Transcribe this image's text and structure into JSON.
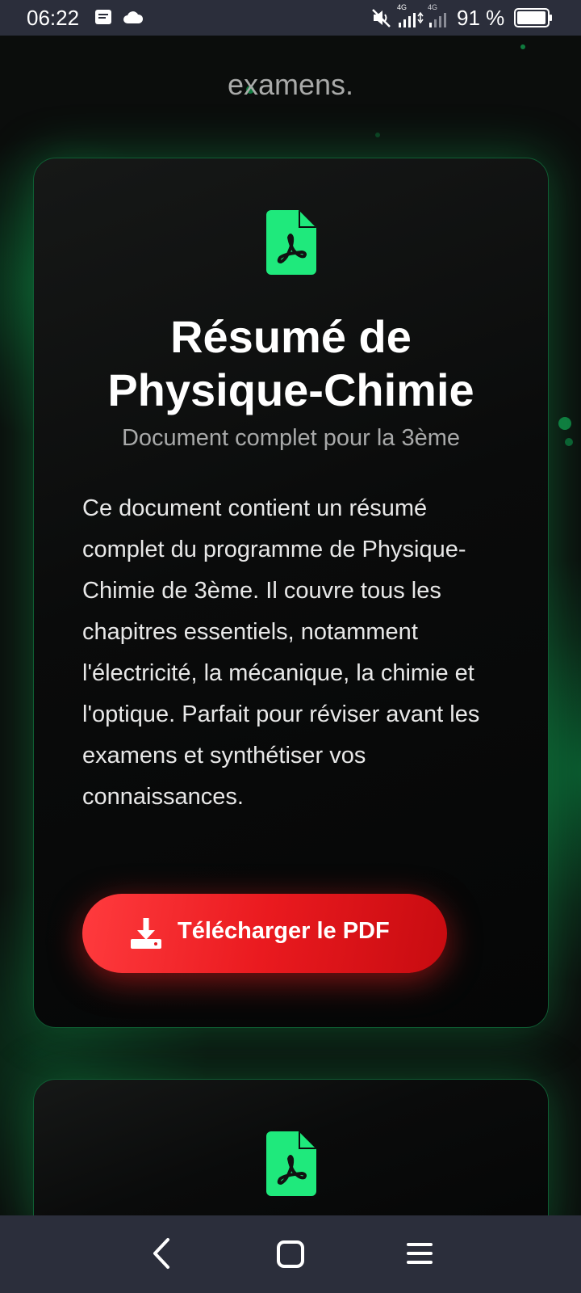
{
  "status_bar": {
    "time": "06:22",
    "battery_percent": "91 %",
    "network_label_1": "4G",
    "network_label_2": "4G",
    "icons": [
      "notes-icon",
      "cloud-icon",
      "mute-icon",
      "signal-icon",
      "signal-icon",
      "battery-icon"
    ]
  },
  "previous_section": {
    "trailing_text": "examens."
  },
  "card1": {
    "icon": "pdf-file-icon",
    "title_line1": "Résumé de",
    "title_line2": "Physique-Chimie",
    "subtitle": "Document complet pour la 3ème",
    "description": "Ce document contient un résumé complet du programme de Physique-Chimie de 3ème. Il couvre tous les chapitres essentiels, notamment l'électricité, la mécanique, la chimie et l'optique. Parfait pour réviser avant les examens et synthétiser vos connaissances.",
    "download_label": "Télécharger le PDF",
    "download_icon": "download-icon"
  },
  "card2": {
    "icon": "pdf-file-icon"
  },
  "nav_bar": {
    "icons": [
      "back-icon",
      "home-icon",
      "menu-icon"
    ]
  },
  "colors": {
    "accent_green": "#1fe97c",
    "button_red": "#ea1a1f",
    "background": "#0b0d0c",
    "system_bar": "#2b2e3b"
  }
}
